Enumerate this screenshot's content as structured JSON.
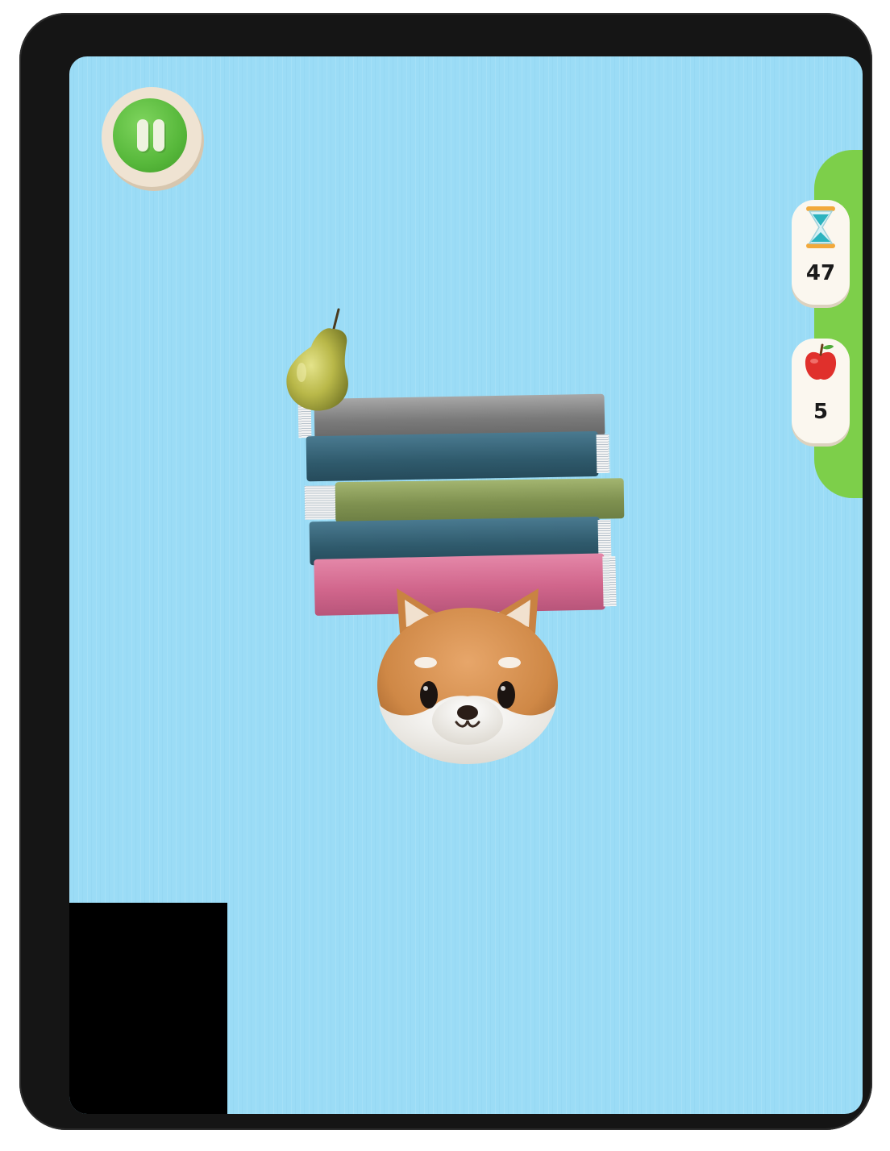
{
  "hud": {
    "timer": {
      "icon": "hourglass-icon",
      "value": "47"
    },
    "fruit_count": {
      "icon": "apple-icon",
      "value": "5"
    },
    "pause": {
      "icon": "pause-icon"
    }
  },
  "scene": {
    "top_item": "pear",
    "books": [
      {
        "color": "#8b8b8b",
        "name": "gray"
      },
      {
        "color": "#3e6c82",
        "name": "teal"
      },
      {
        "color": "#8da15a",
        "name": "olive"
      },
      {
        "color": "#3e6c82",
        "name": "teal"
      },
      {
        "color": "#d76c92",
        "name": "pink"
      }
    ],
    "character": "shiba-inu-dog"
  },
  "colors": {
    "background": "#9bdcf6",
    "accent_green": "#57b83b",
    "panel_green": "#7dcf4a",
    "card": "#fbf7ef"
  }
}
